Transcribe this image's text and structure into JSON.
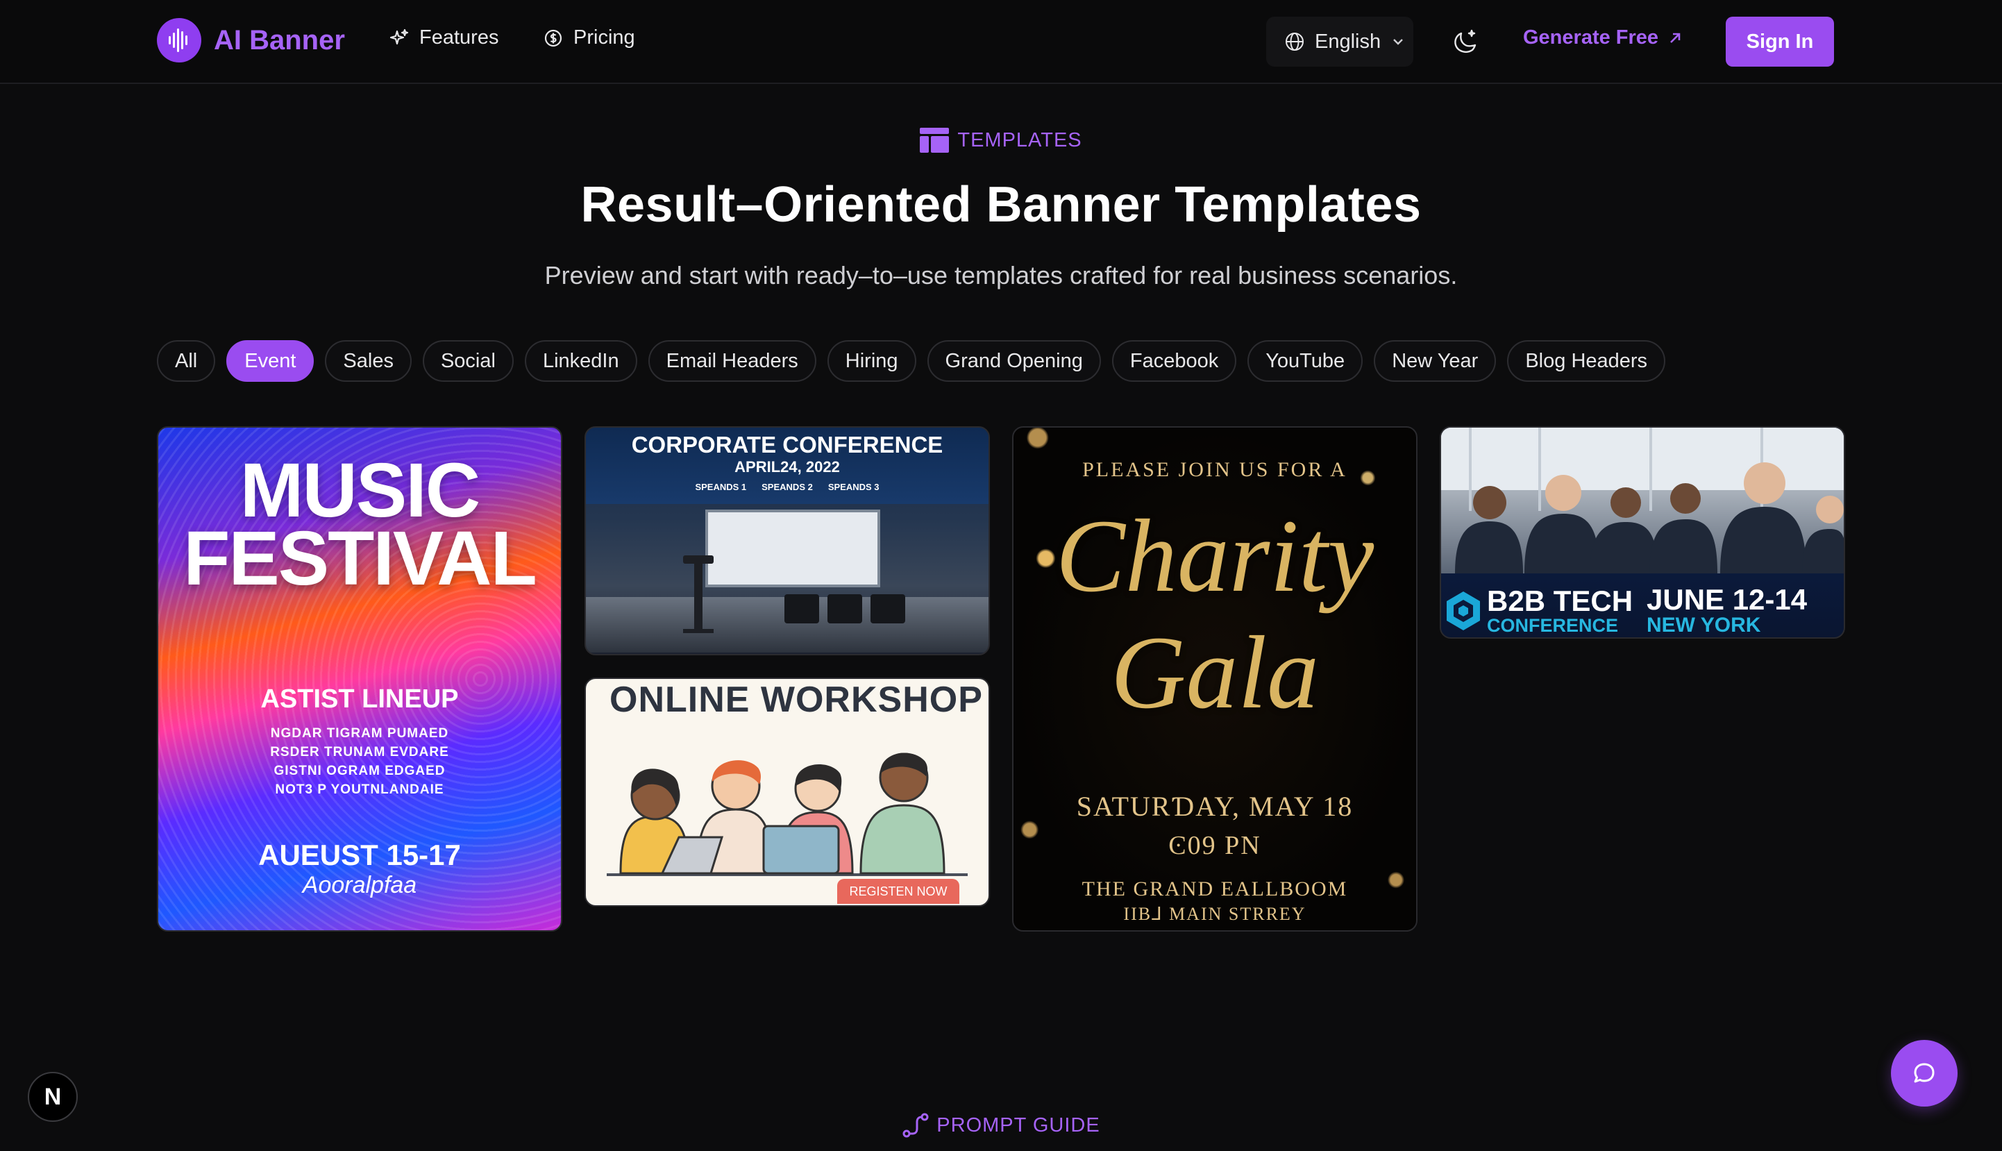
{
  "header": {
    "logo_text": "AI Banner",
    "nav": [
      {
        "label": "Features",
        "icon": "sparkles-icon"
      },
      {
        "label": "Pricing",
        "icon": "dollar-circle-icon"
      }
    ],
    "language": "English",
    "generate_label": "Generate Free",
    "signin_label": "Sign In"
  },
  "hero": {
    "tag": "TEMPLATES",
    "title": "Result–Oriented Banner Templates",
    "subtitle": "Preview and start with ready–to–use templates crafted for real business scenarios."
  },
  "filters": {
    "items": [
      "All",
      "Event",
      "Sales",
      "Social",
      "LinkedIn",
      "Email Headers",
      "Hiring",
      "Grand Opening",
      "Facebook",
      "YouTube",
      "New Year",
      "Blog Headers"
    ],
    "active": "Event"
  },
  "cards": {
    "music": {
      "line1": "MUSIC",
      "line2": "FESTIVAL",
      "lineup": "ASTIST LINEUP",
      "rows": [
        "NGDAR TIGRAM PUMAED",
        "RSDER TRUNAM EVDARE",
        "GISTNI OGRAM EDGAED",
        "NOT3 P YOUTNLANDAIE"
      ],
      "dates": "AUEUST 15-17",
      "venue": "Aooralpfaa"
    },
    "corporate": {
      "title": "CORPORATE CONFERENCE",
      "date": "APRIL24, 2022",
      "speakers": [
        "SPEANDS 1",
        "SPEANDS 2",
        "SPEANDS 3"
      ]
    },
    "workshop": {
      "title": "ONLINE WORKSHOP",
      "button": "REGISTEN NOW"
    },
    "gala": {
      "join": "PLEASE JOIN US FOR A",
      "script1": "Charity",
      "script2": "Gala",
      "date": "SATURƊAY, MAY 18",
      "time": "Ͼ09 PN",
      "hall": "THE GRAND EALLBOOM",
      "street": "IIB⅃ MAIN STRREY"
    },
    "b2b": {
      "title": "B2B TECH",
      "subtitle": "CONFERENCE",
      "dates": "JUNE 12-14",
      "city": "NEW YORK"
    }
  },
  "footer": {
    "prompt_tag": "PROMPT GUIDE",
    "nx_label": "N"
  },
  "colors": {
    "accent": "#9a4cf0",
    "accent_text": "#a663f7",
    "background": "#0c0c0d"
  }
}
